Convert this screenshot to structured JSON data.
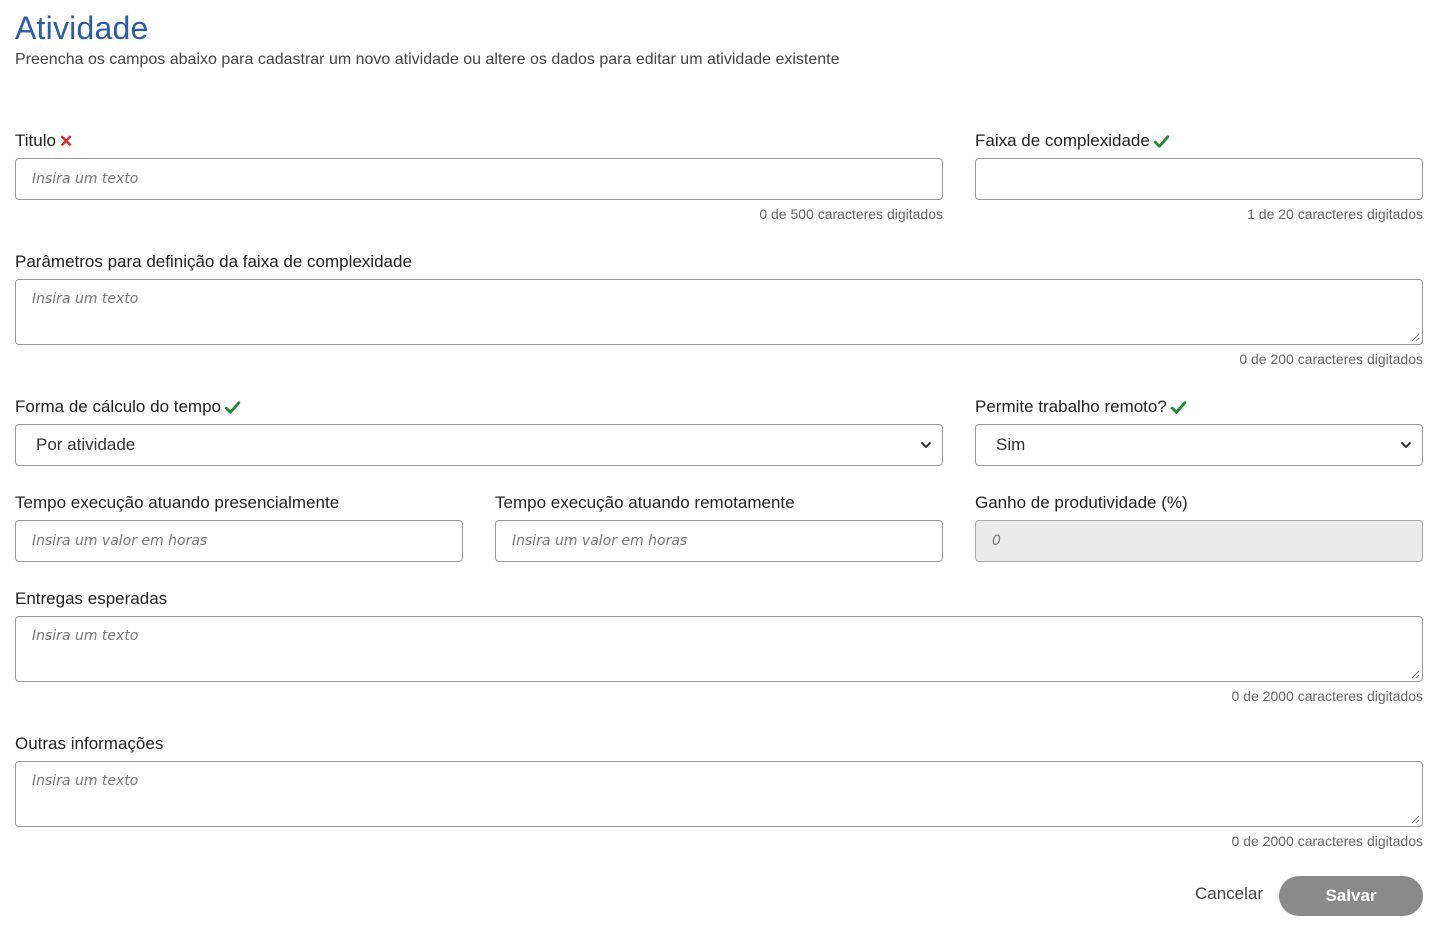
{
  "header": {
    "title": "Atividade",
    "subtitle": "Preencha os campos abaixo para cadastrar um novo atividade ou altere os dados para editar um atividade existente"
  },
  "fields": {
    "titulo": {
      "label": "Titulo",
      "placeholder": "Insira um texto",
      "value": "",
      "counter": "0 de 500 caracteres digitados",
      "status": "invalid"
    },
    "faixa": {
      "label": "Faixa de complexidade",
      "placeholder": "",
      "value": "",
      "counter": "1 de 20 caracteres digitados",
      "status": "valid"
    },
    "parametros": {
      "label": "Parâmetros para definição da faixa de complexidade",
      "placeholder": "Insira um texto",
      "counter": "0 de 200 caracteres digitados"
    },
    "forma_calculo": {
      "label": "Forma de cálculo do tempo",
      "selected": "Por atividade",
      "status": "valid"
    },
    "remoto": {
      "label": "Permite trabalho remoto?",
      "selected": "Sim",
      "status": "valid"
    },
    "tempo_presencial": {
      "label": "Tempo execução atuando presencialmente",
      "placeholder": "Insira um valor em horas"
    },
    "tempo_remoto": {
      "label": "Tempo execução atuando remotamente",
      "placeholder": "Insira um valor em horas"
    },
    "ganho": {
      "label": "Ganho de produtividade (%)",
      "placeholder": "0"
    },
    "entregas": {
      "label": "Entregas esperadas",
      "placeholder": "Insira um texto",
      "counter": "0 de 2000 caracteres digitados"
    },
    "outras": {
      "label": "Outras informações",
      "placeholder": "Insira um texto",
      "counter": "0 de 2000 caracteres digitados"
    }
  },
  "actions": {
    "cancel_label": "Cancelar",
    "save_label": "Salvar"
  },
  "colors": {
    "accent": "#2a5ca8",
    "valid": "#1e8a2e",
    "invalid": "#e02424",
    "save_disabled": "#8a8a8a"
  }
}
